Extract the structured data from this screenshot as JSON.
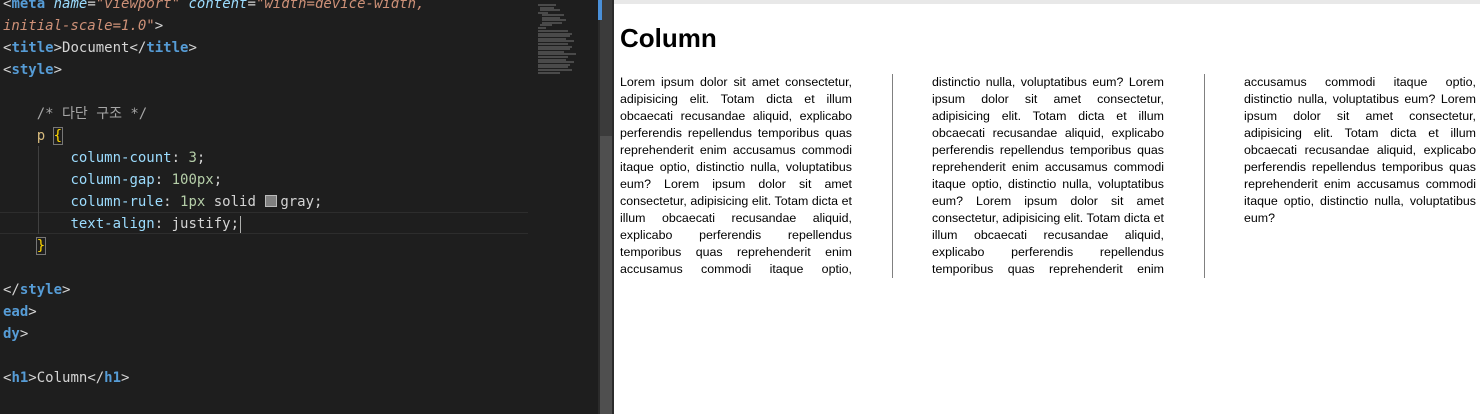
{
  "editor": {
    "lines": [
      {
        "parts": [
          {
            "t": "<",
            "c": "punct"
          },
          {
            "t": "meta",
            "c": "tagname"
          },
          {
            "t": " ",
            "c": "punct"
          },
          {
            "t": "name",
            "c": "attr"
          },
          {
            "t": "=",
            "c": "punct"
          },
          {
            "t": "\"viewport\"",
            "c": "str"
          },
          {
            "t": " ",
            "c": "punct"
          },
          {
            "t": "content",
            "c": "attr"
          },
          {
            "t": "=",
            "c": "punct"
          },
          {
            "t": "\"width=device-width,",
            "c": "str"
          }
        ]
      },
      {
        "parts": [
          {
            "t": "initial-scale=1.0\"",
            "c": "str"
          },
          {
            "t": ">",
            "c": "punct"
          }
        ]
      },
      {
        "parts": [
          {
            "t": "<",
            "c": "punct"
          },
          {
            "t": "title",
            "c": "tagname"
          },
          {
            "t": ">",
            "c": "punct"
          },
          {
            "t": "Document",
            "c": "kw"
          },
          {
            "t": "</",
            "c": "punct"
          },
          {
            "t": "title",
            "c": "tagname"
          },
          {
            "t": ">",
            "c": "punct"
          }
        ]
      },
      {
        "parts": [
          {
            "t": "<",
            "c": "punct"
          },
          {
            "t": "style",
            "c": "tagname"
          },
          {
            "t": ">",
            "c": "punct"
          }
        ]
      },
      {
        "parts": []
      },
      {
        "parts": [
          {
            "t": "    /* 다단 구조 */",
            "c": "comment"
          }
        ]
      },
      {
        "parts": [
          {
            "t": "    ",
            "c": "kw"
          },
          {
            "t": "p",
            "c": "selector"
          },
          {
            "t": " ",
            "c": "kw"
          },
          {
            "t": "{",
            "c": "brace-yellow"
          }
        ]
      },
      {
        "parts": [
          {
            "t": "        ",
            "c": "kw"
          },
          {
            "t": "column-count",
            "c": "prop"
          },
          {
            "t": ": ",
            "c": "kw"
          },
          {
            "t": "3",
            "c": "num"
          },
          {
            "t": ";",
            "c": "kw"
          }
        ]
      },
      {
        "parts": [
          {
            "t": "        ",
            "c": "kw"
          },
          {
            "t": "column-gap",
            "c": "prop"
          },
          {
            "t": ": ",
            "c": "kw"
          },
          {
            "t": "100px",
            "c": "num"
          },
          {
            "t": ";",
            "c": "kw"
          }
        ]
      },
      {
        "parts": [
          {
            "t": "        ",
            "c": "kw"
          },
          {
            "t": "column-rule",
            "c": "prop"
          },
          {
            "t": ": ",
            "c": "kw"
          },
          {
            "t": "1px",
            "c": "num"
          },
          {
            "t": " solid ",
            "c": "kw"
          },
          {
            "t": "SWATCH",
            "c": "swatch"
          },
          {
            "t": "gray",
            "c": "kw"
          },
          {
            "t": ";",
            "c": "kw"
          }
        ]
      },
      {
        "parts": [
          {
            "t": "        ",
            "c": "kw"
          },
          {
            "t": "text-align",
            "c": "prop"
          },
          {
            "t": ": ",
            "c": "kw"
          },
          {
            "t": "justify",
            "c": "kw"
          },
          {
            "t": ";",
            "c": "kw"
          },
          {
            "t": "CURSOR",
            "c": "cursor"
          }
        ]
      },
      {
        "parts": [
          {
            "t": "    ",
            "c": "kw"
          },
          {
            "t": "}",
            "c": "brace-yellow"
          }
        ]
      },
      {
        "parts": []
      },
      {
        "parts": [
          {
            "t": "</",
            "c": "punct"
          },
          {
            "t": "style",
            "c": "tagname"
          },
          {
            "t": ">",
            "c": "punct"
          }
        ]
      },
      {
        "parts": [
          {
            "t": "ead",
            "c": "tagname"
          },
          {
            "t": ">",
            "c": "punct"
          }
        ]
      },
      {
        "parts": [
          {
            "t": "dy",
            "c": "tagname"
          },
          {
            "t": ">",
            "c": "punct"
          }
        ]
      },
      {
        "parts": []
      },
      {
        "parts": [
          {
            "t": "<",
            "c": "punct"
          },
          {
            "t": "h1",
            "c": "tagname"
          },
          {
            "t": ">",
            "c": "punct"
          },
          {
            "t": "Column",
            "c": "kw"
          },
          {
            "t": "</",
            "c": "punct"
          },
          {
            "t": "h1",
            "c": "tagname"
          },
          {
            "t": ">",
            "c": "punct"
          }
        ]
      }
    ]
  },
  "preview": {
    "heading": "Column",
    "paragraph": "Lorem ipsum dolor sit amet consectetur, adipisicing elit. Totam dicta et illum obcaecati recusandae aliquid, explicabo perferendis repellendus temporibus quas reprehenderit enim accusamus commodi itaque optio, distinctio nulla, voluptatibus eum? Lorem ipsum dolor sit amet consectetur, adipisicing elit. Totam dicta et illum obcaecati recusandae aliquid, explicabo perferendis repellendus temporibus quas reprehenderit enim accusamus commodi itaque optio, distinctio nulla, voluptatibus eum? Lorem ipsum dolor sit amet consectetur, adipisicing elit. Totam dicta et illum obcaecati recusandae aliquid, explicabo perferendis repellendus temporibus quas reprehenderit enim accusamus commodi itaque optio, distinctio nulla, voluptatibus eum? Lorem ipsum dolor sit amet consectetur, adipisicing elit. Totam dicta et illum obcaecati recusandae aliquid, explicabo perferendis repellendus temporibus quas reprehenderit enim accusamus commodi itaque optio, distinctio nulla, voluptatibus eum? Lorem ipsum dolor sit amet consectetur, adipisicing elit. Totam dicta et illum obcaecati recusandae aliquid, explicabo perferendis repellendus temporibus quas reprehenderit enim accusamus commodi itaque optio, distinctio nulla, voluptatibus eum?"
  },
  "colors": {
    "editor_bg": "#1e1e1e",
    "column_rule": "gray"
  }
}
